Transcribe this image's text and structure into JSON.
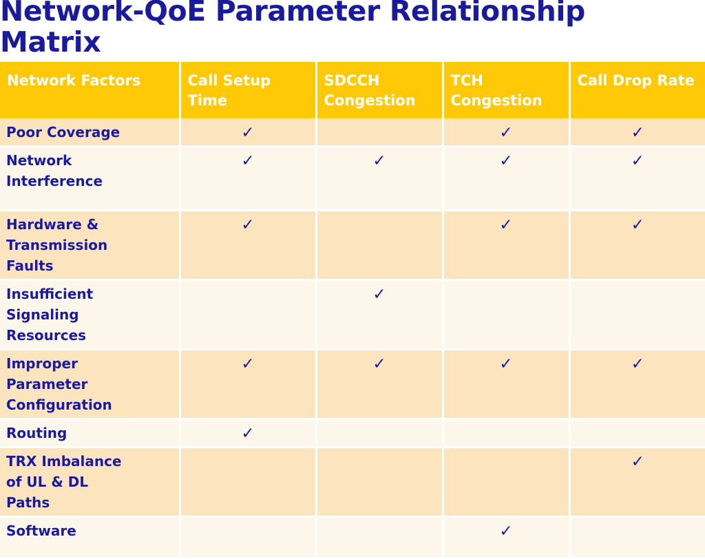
{
  "slide": {
    "title": "Network-QoE Parameter Relationship Matrix",
    "title_color": "#1A1A9C",
    "header_bg_color": "#FFC907",
    "header_text_color": "#FFFFFF",
    "row_shade_dark": "#FCE4BE",
    "row_shade_light": "#FDF6EB",
    "background": "#FFFFFF"
  },
  "matrix": {
    "type": "table",
    "check_glyph": "✓",
    "columns": [
      {
        "key": "factor",
        "label": "Network Factors"
      },
      {
        "key": "call_setup_time",
        "label": "Call Setup Time"
      },
      {
        "key": "sdcch_congestion",
        "label": "SDCCH Congestion"
      },
      {
        "key": "tch_congestion",
        "label": "TCH Congestion"
      },
      {
        "key": "call_drop_rate",
        "label": "Call Drop Rate"
      }
    ],
    "rows": [
      {
        "factor": "Poor  Coverage",
        "marks": [
          "✓",
          "",
          "✓",
          "✓"
        ]
      },
      {
        "factor": "Network\nInterference",
        "marks": [
          "✓",
          "✓",
          "✓",
          "✓"
        ]
      },
      {
        "factor": "Hardware  &\nTransmission\nFaults",
        "marks": [
          "✓",
          "",
          "✓",
          "✓"
        ]
      },
      {
        "factor": "Insufficient\nSignaling\nResources",
        "marks": [
          "",
          "✓",
          "",
          ""
        ]
      },
      {
        "factor": "Improper\nParameter\nConfiguration",
        "marks": [
          "✓",
          "✓",
          "✓",
          "✓"
        ]
      },
      {
        "factor": "Routing",
        "marks": [
          "✓",
          "",
          "",
          ""
        ]
      },
      {
        "factor": "TRX Imbalance\nof UL &  DL\nPaths",
        "marks": [
          "",
          "",
          "",
          "✓"
        ]
      },
      {
        "factor": "Software",
        "marks": [
          "",
          "",
          "✓",
          ""
        ]
      }
    ]
  }
}
